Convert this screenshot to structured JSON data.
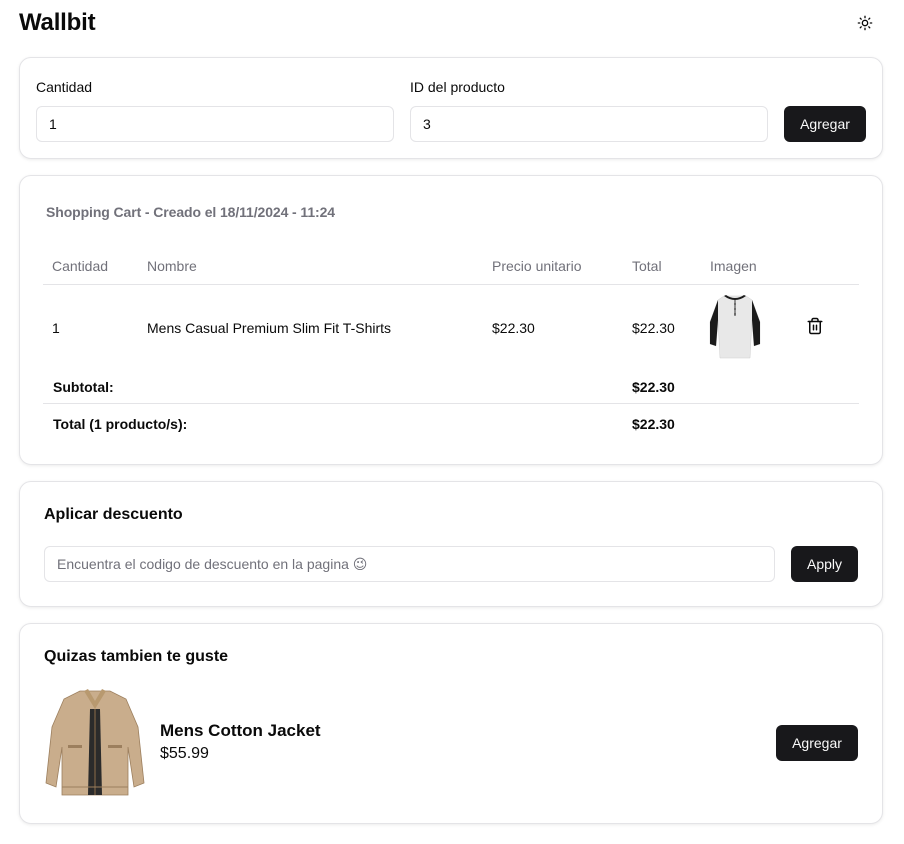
{
  "header": {
    "title": "Wallbit",
    "theme_icon": "sun-icon"
  },
  "add_form": {
    "quantity_label": "Cantidad",
    "quantity_value": "1",
    "product_id_label": "ID del producto",
    "product_id_value": "3",
    "add_button": "Agregar"
  },
  "cart": {
    "caption": "Shopping Cart - Creado el 18/11/2024 - 11:24",
    "columns": [
      "Cantidad",
      "Nombre",
      "Precio unitario",
      "Total",
      "Imagen"
    ],
    "rows": [
      {
        "quantity": "1",
        "name": "Mens Casual Premium Slim Fit T-Shirts",
        "unit_price": "$22.30",
        "total": "$22.30",
        "image": "henley-shirt-image",
        "delete_icon": "trash-icon"
      }
    ],
    "subtotal_label": "Subtotal:",
    "subtotal_value": "$22.30",
    "total_label": "Total (1 producto/s):",
    "total_value": "$22.30"
  },
  "discount": {
    "heading": "Aplicar descuento",
    "placeholder": "Encuentra el codigo de descuento en la pagina 😉",
    "apply_button": "Apply"
  },
  "suggestion": {
    "heading": "Quizas tambien te guste",
    "product_name": "Mens Cotton Jacket",
    "product_price": "$55.99",
    "add_button": "Agregar",
    "image": "cotton-jacket-image"
  },
  "colors": {
    "button_bg": "#18181b",
    "muted_text": "#71717a",
    "border": "#e4e4e7"
  }
}
